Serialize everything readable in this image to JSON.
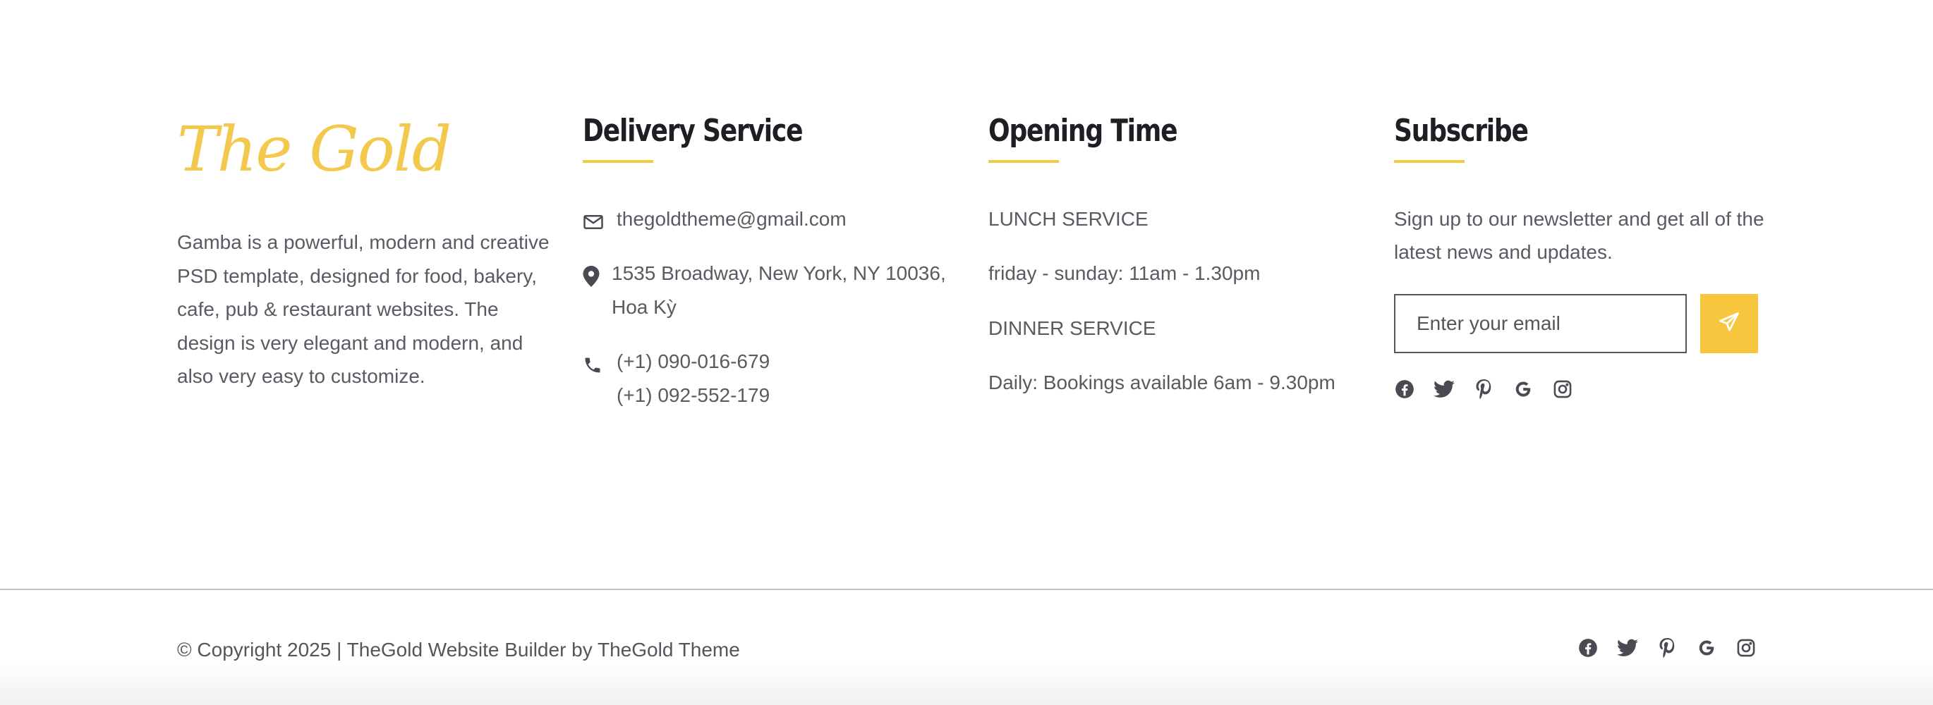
{
  "about": {
    "logo_text": "The Gold",
    "description": "Gamba is a powerful, modern and creative PSD template, designed for food, bakery, cafe, pub & restaurant websites. The design is very elegant and modern, and also very easy to customize."
  },
  "delivery": {
    "title": "Delivery Service",
    "email": "thegoldtheme@gmail.com",
    "address": "1535 Broadway, New York, NY 10036, Hoa Kỳ",
    "phone_1": "(+1) 090-016-679",
    "phone_2": "(+1) 092-552-179",
    "icons": [
      "envelope-icon",
      "map-pin-icon",
      "phone-icon"
    ]
  },
  "opening": {
    "title": "Opening Time",
    "items": [
      "LUNCH SERVICE",
      "friday - sunday: 11am - 1.30pm",
      "DINNER SERVICE",
      "Daily: Bookings available 6am - 9.30pm"
    ]
  },
  "subscribe": {
    "title": "Subscribe",
    "text": "Sign up to our newsletter and get all of the latest news and updates.",
    "email_placeholder": "Enter your email",
    "send_icon": "paper-plane-icon"
  },
  "social_icons": [
    "facebook-icon",
    "twitter-icon",
    "pinterest-icon",
    "google-icon",
    "instagram-icon"
  ],
  "footer": {
    "copyright": "© Copyright 2025 | TheGold Website Builder by TheGold Theme"
  },
  "colors": {
    "accent": "#f5c842",
    "heading": "#1e1e24",
    "text": "#5a5a62",
    "divider": "#c4c4c8"
  }
}
